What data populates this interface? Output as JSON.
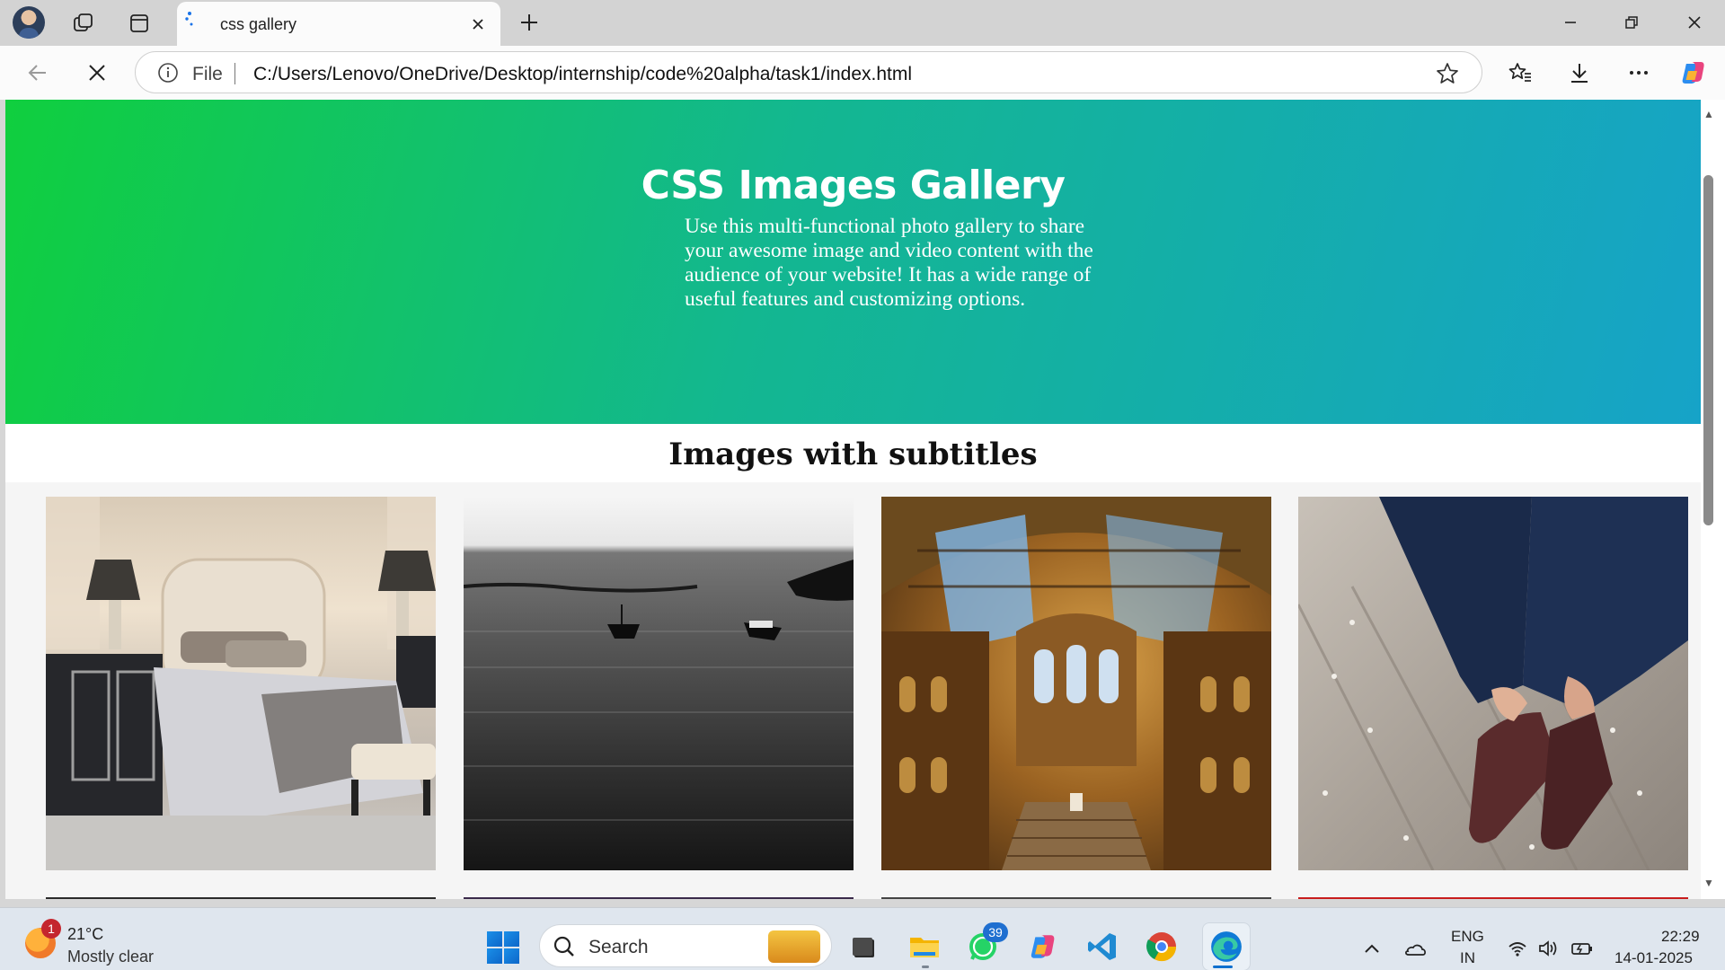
{
  "tab": {
    "title": "css gallery"
  },
  "address_bar": {
    "scheme_label": "File",
    "url": "C:/Users/Lenovo/OneDrive/Desktop/internship/code%20alpha/task1/index.html"
  },
  "page": {
    "hero_title": "CSS Images Gallery",
    "hero_text": "Use this multi-functional photo gallery to share your awesome image and video content with the audience of your website! It has a wide range of useful features and customizing options.",
    "section_title": "Images with subtitles",
    "images": [
      {
        "icon": "bedroom-photo"
      },
      {
        "icon": "sea-boats-photo"
      },
      {
        "icon": "museum-hall-photo"
      },
      {
        "icon": "tying-shoes-photo"
      }
    ]
  },
  "taskbar": {
    "weather": {
      "badge": "1",
      "temperature": "21°C",
      "condition": "Mostly clear"
    },
    "search_label": "Search",
    "whatsapp_badge": "39",
    "language": {
      "line1": "ENG",
      "line2": "IN"
    },
    "clock": {
      "time": "22:29",
      "date": "14-01-2025"
    }
  },
  "colors": {
    "hero_start": "#10cf3e",
    "hero_end": "#16a3c8",
    "accent_blue": "#1a8fe8"
  }
}
